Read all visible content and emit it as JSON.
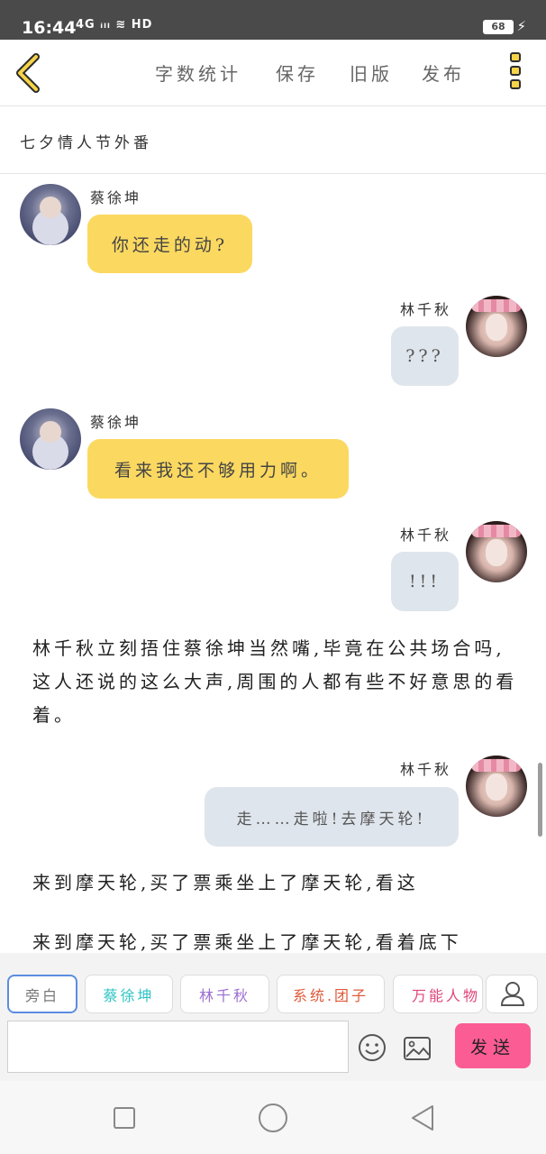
{
  "status_bar": {
    "time": "16:44",
    "signal": "4G ᵢₗₗ ≋ HD",
    "battery": "68"
  },
  "toolbar": {
    "word_count": "字数统计",
    "save": "保存",
    "old_version": "旧版",
    "publish": "发布"
  },
  "chapter": {
    "title": "七夕情人节外番"
  },
  "messages": [
    {
      "speaker": "蔡徐坤",
      "text": "你还走的动?"
    },
    {
      "speaker": "林千秋",
      "text": "???"
    },
    {
      "speaker": "蔡徐坤",
      "text": "看来我还不够用力啊。"
    },
    {
      "speaker": "林千秋",
      "text": "!!!"
    },
    {
      "speaker": "林千秋",
      "text": "走……走啦!去摩天轮!"
    }
  ],
  "narration": [
    "林千秋立刻捂住蔡徐坤当然嘴,毕竟在公共场合吗,这人还说的这么大声,周围的人都有些不好意思的看着。",
    "来到摩天轮,买了票乘坐上了摩天轮,看这",
    "来到摩天轮,买了票乘坐上了摩天轮,看着底下"
  ],
  "roles": [
    {
      "label": "旁白",
      "color": "#777777"
    },
    {
      "label": "蔡徐坤",
      "color": "#2ec4c4"
    },
    {
      "label": "林千秋",
      "color": "#9b6fd0"
    },
    {
      "label": "系统.团子",
      "color": "#e05a3a"
    },
    {
      "label": "万能人物",
      "color": "#e0457a"
    }
  ],
  "compose": {
    "send": "发送"
  },
  "colors": {
    "accent_yellow": "#fbd860",
    "bubble_grey": "#dfe5ec",
    "send_pink": "#fb5c94"
  }
}
